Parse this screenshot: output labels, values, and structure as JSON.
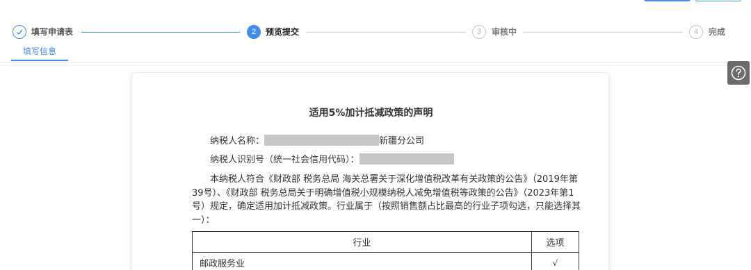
{
  "steps": [
    {
      "number": "✓",
      "label": "填写申请表",
      "state": "done"
    },
    {
      "number": "2",
      "label": "预览提交",
      "state": "active"
    },
    {
      "number": "3",
      "label": "审核中",
      "state": "wait"
    },
    {
      "number": "4",
      "label": "完成",
      "state": "wait"
    }
  ],
  "tabs": [
    {
      "label": "填写信息"
    }
  ],
  "help": {
    "icon": "question-icon",
    "glyph": "?"
  },
  "document": {
    "title": "适用5%加计抵减政策的声明",
    "taxpayer_name_label": "纳税人名称：",
    "taxpayer_name_suffix": "新疆分公司",
    "taxpayer_id_label": "纳税人识别号（统一社会信用代码）：",
    "paragraph": "本纳税人符合《财政部 税务总局 海关总署关于深化增值税改革有关政策的公告》（2019年第39号）、《财政部 税务总局关于明确增值税小规模纳税人减免增值税等政策的公告》（2023年第1号）规定，确定适用加计抵减政策。行业属于（按照销售额占比最高的行业子项勾选，只能选择其一）：",
    "table": {
      "headers": [
        "行业",
        "选项"
      ],
      "rows": [
        {
          "industry": "邮政服务业",
          "option": "√"
        }
      ]
    }
  },
  "colors": {
    "accent": "#3f8ef2",
    "help_bg": "#6b6b6b",
    "redaction": "#c6c6c6"
  }
}
